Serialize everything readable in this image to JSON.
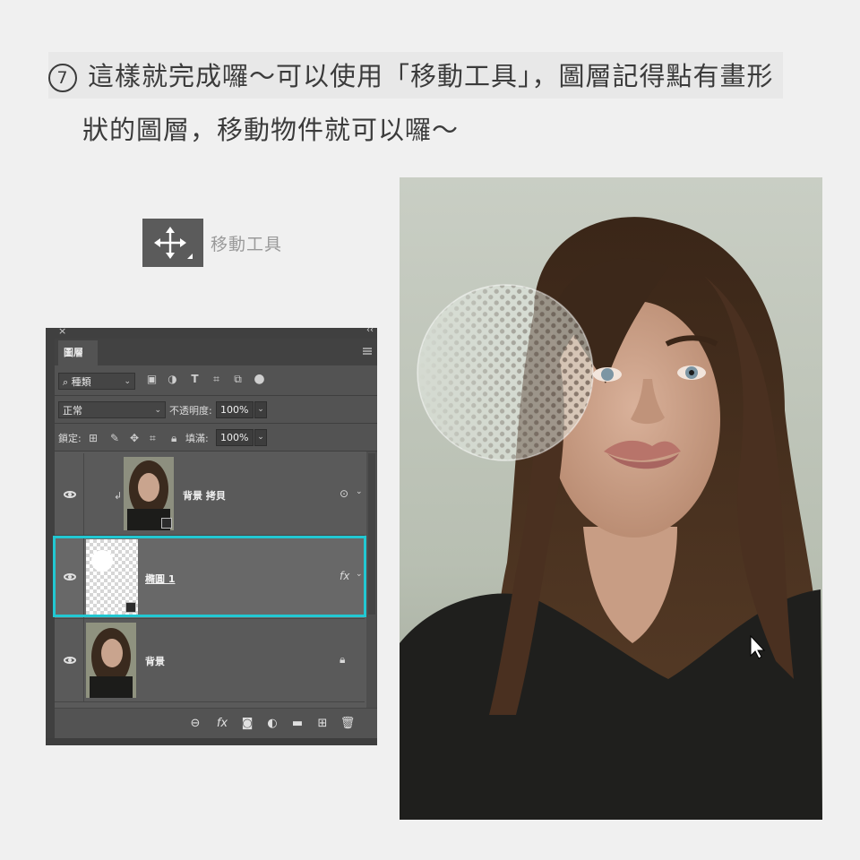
{
  "instruction": {
    "step_number": "7",
    "line1": "這樣就完成囉～可以使用「移動工具」，圖層記得點有畫形",
    "line2": "狀的圖層，移動物件就可以囉～"
  },
  "tool": {
    "icon": "move-arrows-icon",
    "label": "移動工具"
  },
  "layers_panel": {
    "close": "×",
    "collapse": "‹‹",
    "tab_label": "圖層",
    "filter_kind": "種類",
    "blend_mode": "正常",
    "opacity_label": "不透明度:",
    "opacity_value": "100%",
    "lock_label": "鎖定:",
    "fill_label": "填滿:",
    "fill_value": "100%",
    "layers": [
      {
        "name": "背景 拷貝",
        "clipped": true,
        "right_icon": "smart-filter-icon",
        "selected": false
      },
      {
        "name": "橢圓 1",
        "clipped": false,
        "right_icon": "fx",
        "selected": true
      },
      {
        "name": "背景",
        "clipped": false,
        "right_icon": "lock-icon",
        "selected": false
      }
    ],
    "fx_label": "fx",
    "bottom_fx": "fx"
  },
  "colors": {
    "selection": "#22c8d2",
    "panel_bg": "#535353",
    "page_bg": "#f0f0f0"
  }
}
